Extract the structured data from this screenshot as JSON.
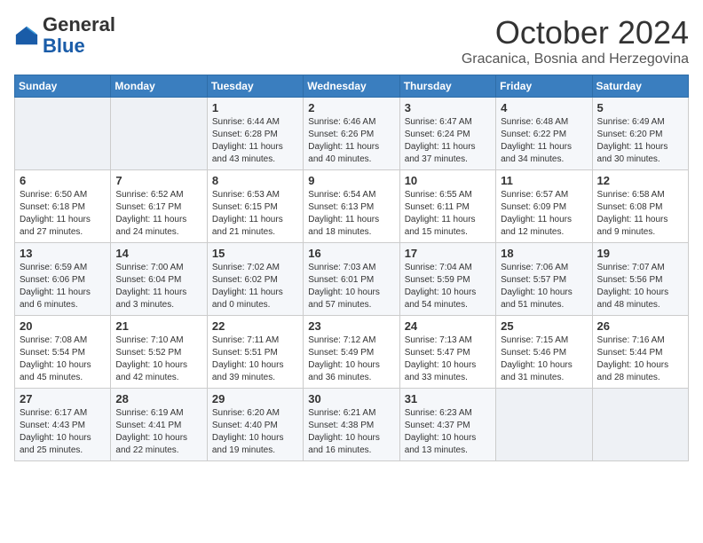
{
  "logo": {
    "general": "General",
    "blue": "Blue"
  },
  "header": {
    "month": "October 2024",
    "location": "Gracanica, Bosnia and Herzegovina"
  },
  "days_of_week": [
    "Sunday",
    "Monday",
    "Tuesday",
    "Wednesday",
    "Thursday",
    "Friday",
    "Saturday"
  ],
  "weeks": [
    [
      {
        "day": "",
        "content": ""
      },
      {
        "day": "",
        "content": ""
      },
      {
        "day": "1",
        "sunrise": "6:44 AM",
        "sunset": "6:28 PM",
        "daylight": "11 hours and 43 minutes."
      },
      {
        "day": "2",
        "sunrise": "6:46 AM",
        "sunset": "6:26 PM",
        "daylight": "11 hours and 40 minutes."
      },
      {
        "day": "3",
        "sunrise": "6:47 AM",
        "sunset": "6:24 PM",
        "daylight": "11 hours and 37 minutes."
      },
      {
        "day": "4",
        "sunrise": "6:48 AM",
        "sunset": "6:22 PM",
        "daylight": "11 hours and 34 minutes."
      },
      {
        "day": "5",
        "sunrise": "6:49 AM",
        "sunset": "6:20 PM",
        "daylight": "11 hours and 30 minutes."
      }
    ],
    [
      {
        "day": "6",
        "sunrise": "6:50 AM",
        "sunset": "6:18 PM",
        "daylight": "11 hours and 27 minutes."
      },
      {
        "day": "7",
        "sunrise": "6:52 AM",
        "sunset": "6:17 PM",
        "daylight": "11 hours and 24 minutes."
      },
      {
        "day": "8",
        "sunrise": "6:53 AM",
        "sunset": "6:15 PM",
        "daylight": "11 hours and 21 minutes."
      },
      {
        "day": "9",
        "sunrise": "6:54 AM",
        "sunset": "6:13 PM",
        "daylight": "11 hours and 18 minutes."
      },
      {
        "day": "10",
        "sunrise": "6:55 AM",
        "sunset": "6:11 PM",
        "daylight": "11 hours and 15 minutes."
      },
      {
        "day": "11",
        "sunrise": "6:57 AM",
        "sunset": "6:09 PM",
        "daylight": "11 hours and 12 minutes."
      },
      {
        "day": "12",
        "sunrise": "6:58 AM",
        "sunset": "6:08 PM",
        "daylight": "11 hours and 9 minutes."
      }
    ],
    [
      {
        "day": "13",
        "sunrise": "6:59 AM",
        "sunset": "6:06 PM",
        "daylight": "11 hours and 6 minutes."
      },
      {
        "day": "14",
        "sunrise": "7:00 AM",
        "sunset": "6:04 PM",
        "daylight": "11 hours and 3 minutes."
      },
      {
        "day": "15",
        "sunrise": "7:02 AM",
        "sunset": "6:02 PM",
        "daylight": "11 hours and 0 minutes."
      },
      {
        "day": "16",
        "sunrise": "7:03 AM",
        "sunset": "6:01 PM",
        "daylight": "10 hours and 57 minutes."
      },
      {
        "day": "17",
        "sunrise": "7:04 AM",
        "sunset": "5:59 PM",
        "daylight": "10 hours and 54 minutes."
      },
      {
        "day": "18",
        "sunrise": "7:06 AM",
        "sunset": "5:57 PM",
        "daylight": "10 hours and 51 minutes."
      },
      {
        "day": "19",
        "sunrise": "7:07 AM",
        "sunset": "5:56 PM",
        "daylight": "10 hours and 48 minutes."
      }
    ],
    [
      {
        "day": "20",
        "sunrise": "7:08 AM",
        "sunset": "5:54 PM",
        "daylight": "10 hours and 45 minutes."
      },
      {
        "day": "21",
        "sunrise": "7:10 AM",
        "sunset": "5:52 PM",
        "daylight": "10 hours and 42 minutes."
      },
      {
        "day": "22",
        "sunrise": "7:11 AM",
        "sunset": "5:51 PM",
        "daylight": "10 hours and 39 minutes."
      },
      {
        "day": "23",
        "sunrise": "7:12 AM",
        "sunset": "5:49 PM",
        "daylight": "10 hours and 36 minutes."
      },
      {
        "day": "24",
        "sunrise": "7:13 AM",
        "sunset": "5:47 PM",
        "daylight": "10 hours and 33 minutes."
      },
      {
        "day": "25",
        "sunrise": "7:15 AM",
        "sunset": "5:46 PM",
        "daylight": "10 hours and 31 minutes."
      },
      {
        "day": "26",
        "sunrise": "7:16 AM",
        "sunset": "5:44 PM",
        "daylight": "10 hours and 28 minutes."
      }
    ],
    [
      {
        "day": "27",
        "sunrise": "6:17 AM",
        "sunset": "4:43 PM",
        "daylight": "10 hours and 25 minutes."
      },
      {
        "day": "28",
        "sunrise": "6:19 AM",
        "sunset": "4:41 PM",
        "daylight": "10 hours and 22 minutes."
      },
      {
        "day": "29",
        "sunrise": "6:20 AM",
        "sunset": "4:40 PM",
        "daylight": "10 hours and 19 minutes."
      },
      {
        "day": "30",
        "sunrise": "6:21 AM",
        "sunset": "4:38 PM",
        "daylight": "10 hours and 16 minutes."
      },
      {
        "day": "31",
        "sunrise": "6:23 AM",
        "sunset": "4:37 PM",
        "daylight": "10 hours and 13 minutes."
      },
      {
        "day": "",
        "content": ""
      },
      {
        "day": "",
        "content": ""
      }
    ]
  ]
}
